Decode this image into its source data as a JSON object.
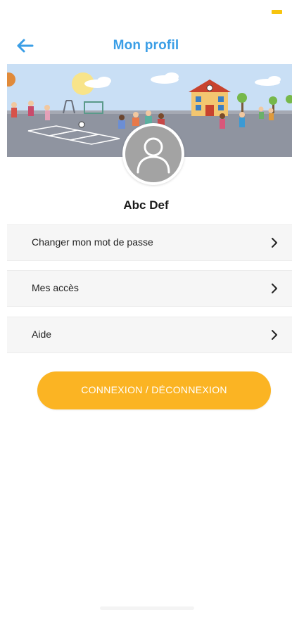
{
  "header": {
    "back_icon": "arrow-left-icon",
    "title": "Mon profil"
  },
  "banner": {
    "image": "school-playground-illustration"
  },
  "profile": {
    "avatar_icon": "user-placeholder-icon",
    "name": "Abc Def"
  },
  "menu": {
    "items": [
      {
        "label": "Changer mon mot de passe",
        "icon": "chevron-right-icon"
      },
      {
        "label": "Mes accès",
        "icon": "chevron-right-icon"
      },
      {
        "label": "Aide",
        "icon": "chevron-right-icon"
      }
    ]
  },
  "actions": {
    "connect_label": "CONNEXION / DÉCONNEXION"
  },
  "colors": {
    "accent_blue": "#3a9ee6",
    "button_orange": "#fbb423",
    "status_yellow": "#f7c40e",
    "avatar_gray": "#a3a3a3",
    "menu_bg": "#f6f6f6"
  }
}
